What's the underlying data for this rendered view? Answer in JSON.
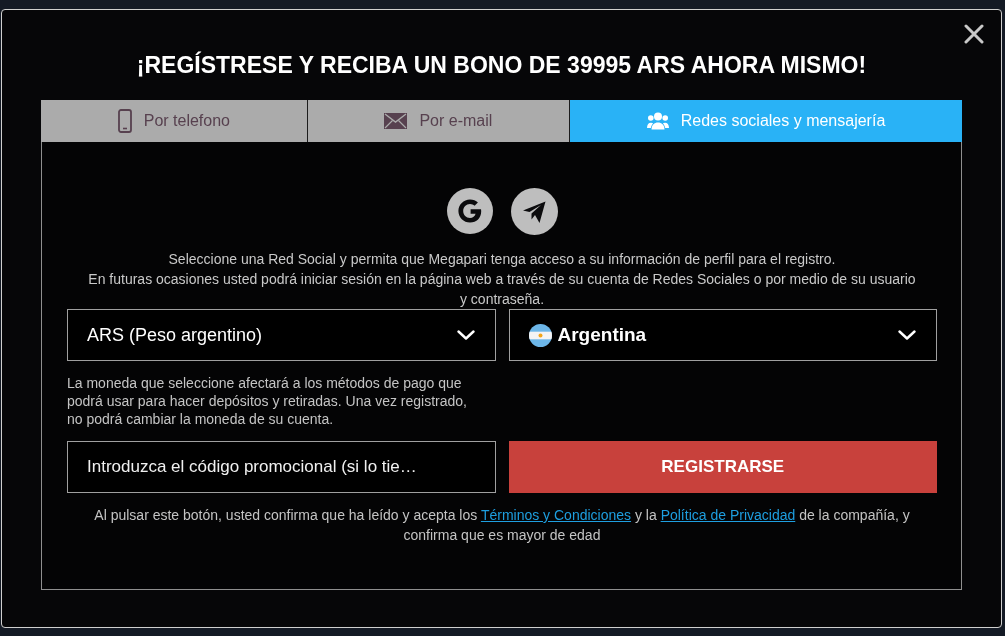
{
  "title": "¡REGÍSTRESE Y RECIBA UN BONO DE 39995 ARS AHORA MISMO!",
  "tabs": [
    {
      "label": "Por telefono",
      "kind": "phone",
      "selected": false
    },
    {
      "label": "Por e-mail",
      "kind": "email",
      "selected": false
    },
    {
      "label": "Redes sociales y mensajería",
      "kind": "social",
      "selected": true
    }
  ],
  "social_buttons": [
    {
      "kind": "google"
    },
    {
      "kind": "telegram"
    }
  ],
  "description": [
    "Seleccione una Red Social y permita que Megapari tenga acceso a su información de perfil para el registro.",
    "En futuras ocasiones usted podrá iniciar sesión en la página web a través de su cuenta de Redes Sociales o por medio de su usuario y contraseña."
  ],
  "currency_dropdown": {
    "value": "ARS (Peso argentino)"
  },
  "country_dropdown": {
    "value": "Argentina"
  },
  "currency_note": "La moneda que seleccione afectará a los métodos de pago que podrá usar para hacer depósitos y retiradas. Una vez registrado, no podrá cambiar la moneda de su cuenta.",
  "promo_code_field": {
    "placeholder": "Introduzca el código promocional (si lo tie…"
  },
  "register_button": {
    "label": "REGISTRARSE"
  },
  "terms": [
    {
      "kind": "text",
      "text": "Al pulsar este botón, usted confirma que ha leído y acepta los "
    },
    {
      "kind": "link",
      "text": "Términos y Condiciones"
    },
    {
      "kind": "text",
      "text": " y la "
    },
    {
      "kind": "link",
      "text": "Política de Privacidad"
    },
    {
      "kind": "text",
      "text": " de la compañía, y confirma que es mayor de edad"
    }
  ]
}
